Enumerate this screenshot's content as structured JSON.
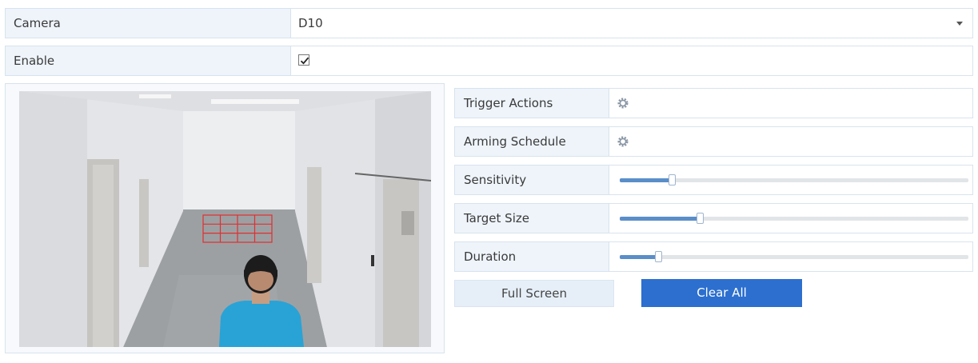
{
  "camera": {
    "label": "Camera",
    "value": "D10"
  },
  "enable": {
    "label": "Enable",
    "checked": true
  },
  "settings": {
    "trigger_actions": {
      "label": "Trigger Actions",
      "icon": "gear-icon"
    },
    "arming_schedule": {
      "label": "Arming Schedule",
      "icon": "gear-icon"
    },
    "sensitivity": {
      "label": "Sensitivity",
      "level": 0.15
    },
    "target_size": {
      "label": "Target Size",
      "level": 0.23
    },
    "duration": {
      "label": "Duration",
      "level": 0.11
    }
  },
  "buttons": {
    "full_screen": "Full Screen",
    "clear_all": "Clear All"
  },
  "colors": {
    "accent": "#2c6fcf",
    "slider_fill": "#5a8ec8",
    "grid": "#e03030"
  }
}
